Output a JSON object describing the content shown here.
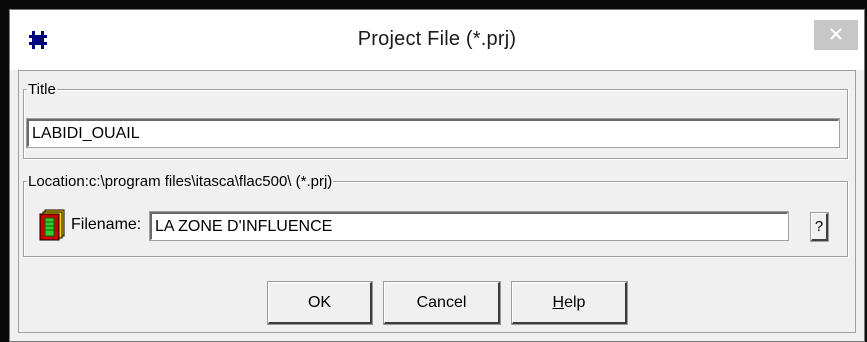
{
  "window": {
    "title": "Project File (*.prj)",
    "app_icon": "grid-frame-icon",
    "close_icon": "close-icon"
  },
  "title_group": {
    "legend": "Title",
    "value": "LABIDI_OUAIL"
  },
  "location_group": {
    "legend": "Location:c:\\program files\\itasca\\flac500\\ (*.prj)",
    "file_icon": "book-icon",
    "filename_label": "Filename:",
    "filename_value": "LA ZONE D'INFLUENCE",
    "browse_label": "?"
  },
  "buttons": {
    "ok_label": "OK",
    "cancel_label": "Cancel",
    "help_mnemonic": "H",
    "help_rest": "elp"
  },
  "colors": {
    "dialog_bg": "#f0f0f0",
    "titlebar_bg": "#ffffff",
    "close_button_bg": "#c7c7c7",
    "app_icon_color": "#000080",
    "book_icon_cover": "#cc0000",
    "book_icon_pages": "#ffd700",
    "book_icon_label": "#33cc33"
  }
}
